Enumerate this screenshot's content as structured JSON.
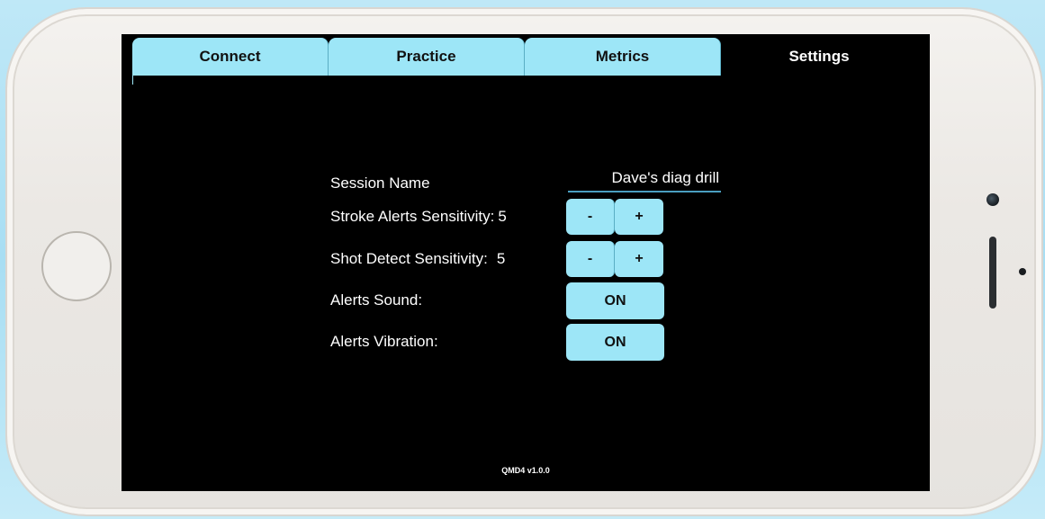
{
  "tabs": [
    {
      "label": "Connect",
      "active": false
    },
    {
      "label": "Practice",
      "active": false
    },
    {
      "label": "Metrics",
      "active": false
    },
    {
      "label": "Settings",
      "active": true
    }
  ],
  "settings": {
    "session_name": {
      "label": "Session Name",
      "value": "Dave's diag drill"
    },
    "stroke_alerts": {
      "label": "Stroke Alerts Sensitivity:",
      "value": "5",
      "minus": "-",
      "plus": "+"
    },
    "shot_detect": {
      "label": "Shot Detect Sensitivity:",
      "value": "5",
      "minus": "-",
      "plus": "+"
    },
    "alerts_sound": {
      "label": "Alerts Sound:",
      "toggle": "ON"
    },
    "alerts_vibration": {
      "label": "Alerts Vibration:",
      "toggle": "ON"
    }
  },
  "footer": {
    "version": "QMD4 v1.0.0"
  },
  "colors": {
    "accent": "#9de6f7",
    "screen_background": "#000000",
    "underline": "#4a9ec0"
  }
}
